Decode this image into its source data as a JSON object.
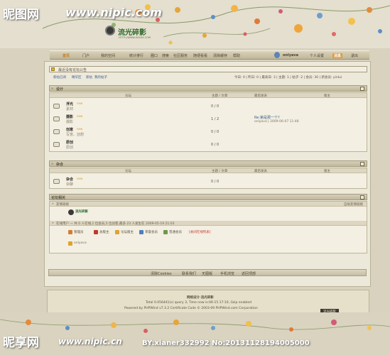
{
  "watermarks": {
    "top_left": "昵图网",
    "top_url": "www.nipic.com",
    "bottom_left": "昵享网",
    "bottom_url": "www.nipic.cn",
    "bottom_right": "BY:xianer332992 No:20131128194005000"
  },
  "logo": {
    "text": "流光碎影",
    "sub": "HTTP://WWW.XXXXX.COM"
  },
  "nav": {
    "left_items": [
      "首页",
      "门户",
      "我的空间",
      "统计排行",
      "圈口",
      "搜索",
      "社区服务",
      "随便看看",
      "清除缓存",
      "帮助"
    ],
    "username": "onlyava",
    "right_items": [
      "个人设置",
      "消息",
      "退出"
    ]
  },
  "announce": {
    "label": "最近没有论坛公告"
  },
  "sub_bar": {
    "left": [
      "新帖已阅",
      "精华区",
      "新帖",
      "我的帖子"
    ],
    "stats": "今日: 0 | 昨日: 0 | 最高日: 3 | 主题: 1 | 帖子: 2 | 会员: 30 | 新会员: yinlui"
  },
  "category_design": {
    "title": "设计",
    "headers": {
      "forum": "论坛",
      "topics": "主题 / 文章",
      "last": "最后发表",
      "mod": "版主"
    },
    "forums": [
      {
        "name": "浮光",
        "desc": "素材",
        "count": "0 / 0",
        "last_title": "",
        "last_by": ""
      },
      {
        "name": "摄影",
        "desc": "摄影",
        "count": "1 / 2",
        "last_title": "Re:第是那一个?",
        "last_by": "onlyava | 2009-06-07 11:48"
      },
      {
        "name": "创意",
        "desc": "写意、创想",
        "count": "0 / 0",
        "last_title": "",
        "last_by": ""
      },
      {
        "name": "原创",
        "desc": "原创",
        "count": "0 / 0",
        "last_title": "",
        "last_by": ""
      }
    ]
  },
  "category_misc": {
    "title": "杂合",
    "headers": {
      "forum": "论坛",
      "topics": "主题 / 文章",
      "last": "最后发表",
      "mod": "版主"
    },
    "forums": [
      {
        "name": "杂合",
        "desc": "杂聊",
        "count": "0 / 0",
        "last_title": "",
        "last_by": ""
      }
    ]
  },
  "related": {
    "title": "论坛相关",
    "links_label": "友情链接",
    "links_right": "自助友情链接",
    "link_logo": "流光碎影",
    "online_label": "在线用户 — 共 0 人在线,1 位会员,5 位访客,最多 23 人发生在 2009-05-19 21:03",
    "legend": [
      "管理员",
      "总版主",
      "论坛版主",
      "荣誉会员",
      "普通会员",
      "[关闭在线列表]"
    ],
    "online_user": "onlyava"
  },
  "footer_links": [
    "清除Cookies",
    "联系我们",
    "无图版",
    "手机浏览",
    "返回顶部"
  ],
  "credit": {
    "title": "网络设计·流光碎影",
    "line1": "Total 0.056441(s) query 3, Time now is:06-15 17:10, Gzip enabled",
    "line2": "Powered by PHPWind v7.3.2 Certificate Code © 2003-09 PHPWind.com Corporation",
    "badge": "流光碎影"
  },
  "colors": {
    "accent": "#c87a1a",
    "red": "#c0392b",
    "panel": "#f3efe2"
  }
}
